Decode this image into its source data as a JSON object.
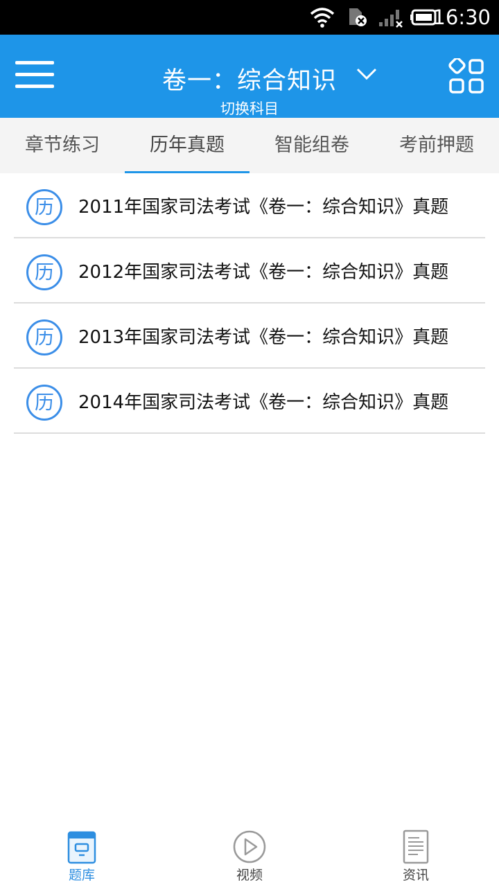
{
  "status_bar": {
    "time": "16:30",
    "icons": [
      "wifi-icon",
      "sim-card-icon",
      "signal-icon",
      "battery-icon"
    ]
  },
  "app_bar": {
    "menu_icon": "hamburger-menu-icon",
    "subject_title": "卷一：综合知识",
    "switch_label": "切换科目",
    "dropdown_icon": "chevron-down-icon",
    "grid_icon": "category-grid-icon",
    "background_color": "#1e95e8"
  },
  "tabs": [
    {
      "label": "章节练习",
      "active": false
    },
    {
      "label": "历年真题",
      "active": true
    },
    {
      "label": "智能组卷",
      "active": false
    },
    {
      "label": "考前押题",
      "active": false
    }
  ],
  "list": {
    "items": [
      {
        "badge": "历",
        "title": "2011年国家司法考试《卷一：综合知识》真题"
      },
      {
        "badge": "历",
        "title": "2012年国家司法考试《卷一：综合知识》真题"
      },
      {
        "badge": "历",
        "title": "2013年国家司法考试《卷一：综合知识》真题"
      },
      {
        "badge": "历",
        "title": "2014年国家司法考试《卷一：综合知识》真题"
      }
    ]
  },
  "bottom_nav": [
    {
      "label": "题库",
      "icon": "question-bank-icon",
      "active": true
    },
    {
      "label": "视频",
      "icon": "play-video-icon",
      "active": false
    },
    {
      "label": "资讯",
      "icon": "news-document-icon",
      "active": false
    }
  ],
  "colors": {
    "accent": "#1e95e8",
    "badge": "#3b8ee8",
    "active_nav": "#2d8ee0"
  }
}
